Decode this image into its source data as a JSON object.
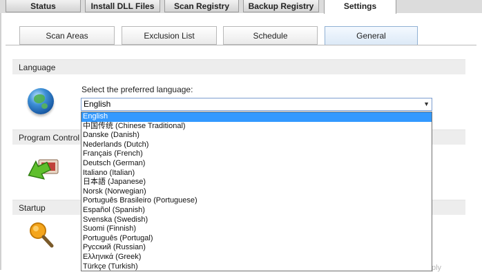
{
  "top_tabs": [
    {
      "label": "Status"
    },
    {
      "label": "Install DLL Files"
    },
    {
      "label": "Scan Registry"
    },
    {
      "label": "Backup Registry"
    },
    {
      "label": "Settings"
    }
  ],
  "sub_tabs": [
    {
      "label": "Scan Areas"
    },
    {
      "label": "Exclusion List"
    },
    {
      "label": "Schedule"
    },
    {
      "label": "General"
    }
  ],
  "sections": {
    "language": "Language",
    "program_control": "Program Control",
    "startup": "Startup"
  },
  "language": {
    "prompt": "Select the preferred language:",
    "selected": "English",
    "options": [
      "English",
      "中国传统 (Chinese Traditional)",
      "Danske (Danish)",
      "Nederlands (Dutch)",
      "Français (French)",
      "Deutsch (German)",
      "Italiano (Italian)",
      "日本語 (Japanese)",
      "Norsk (Norwegian)",
      "Português Brasileiro (Portuguese)",
      "Español (Spanish)",
      "Svenska (Swedish)",
      "Suomi (Finnish)",
      "Português (Portugal)",
      "Русский (Russian)",
      "Ελληνικά (Greek)",
      "Türkçe (Turkish)"
    ]
  },
  "footer": {
    "partial_button": "ply"
  }
}
